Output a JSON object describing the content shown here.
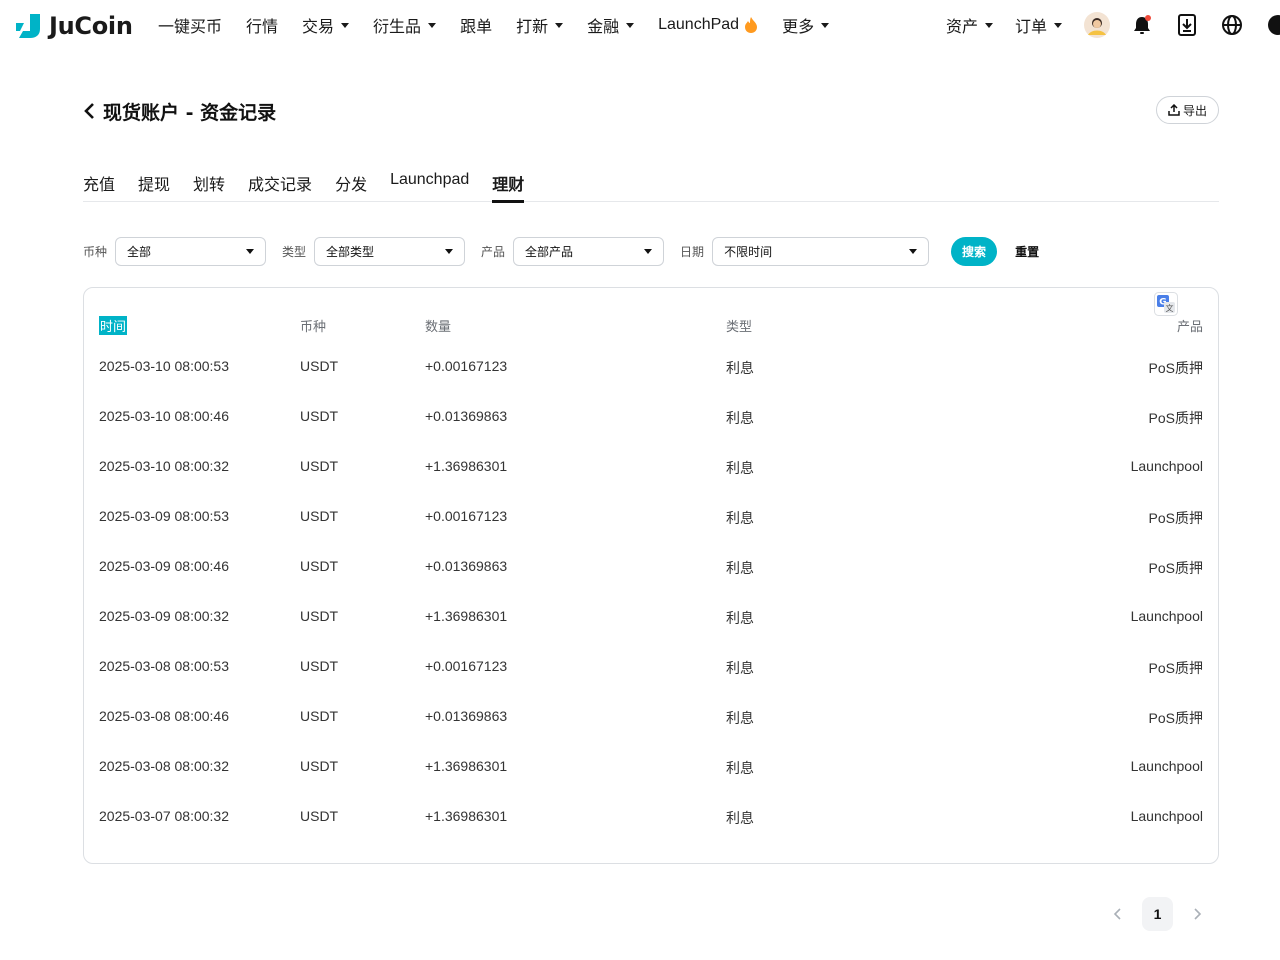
{
  "brand": {
    "name": "JuCoin",
    "accent": "#00b3c7"
  },
  "nav": {
    "items": [
      {
        "label": "一键买币",
        "dropdown": false
      },
      {
        "label": "行情",
        "dropdown": false
      },
      {
        "label": "交易",
        "dropdown": true
      },
      {
        "label": "衍生品",
        "dropdown": true
      },
      {
        "label": "跟单",
        "dropdown": false
      },
      {
        "label": "打新",
        "dropdown": true
      },
      {
        "label": "金融",
        "dropdown": true
      },
      {
        "label": "LaunchPad",
        "dropdown": false,
        "icon": "flame-icon"
      },
      {
        "label": "更多",
        "dropdown": true
      }
    ],
    "right": {
      "assets_label": "资产",
      "orders_label": "订单",
      "icons": [
        "avatar",
        "notification-bell-icon",
        "download-icon",
        "globe-icon",
        "theme-icon"
      ]
    }
  },
  "header": {
    "title": "现货账户 - 资金记录",
    "export_label": "导出"
  },
  "tabs": [
    {
      "label": "充值",
      "active": false
    },
    {
      "label": "提现",
      "active": false
    },
    {
      "label": "划转",
      "active": false
    },
    {
      "label": "成交记录",
      "active": false
    },
    {
      "label": "分发",
      "active": false
    },
    {
      "label": "Launchpad",
      "active": false
    },
    {
      "label": "理财",
      "active": true
    }
  ],
  "filters": {
    "coin": {
      "label": "币种",
      "value": "全部"
    },
    "type": {
      "label": "类型",
      "value": "全部类型"
    },
    "product": {
      "label": "产品",
      "value": "全部产品"
    },
    "date": {
      "label": "日期",
      "value": "不限时间"
    },
    "search_label": "搜索",
    "reset_label": "重置"
  },
  "table": {
    "columns": [
      "时间",
      "币种",
      "数量",
      "类型",
      "产品"
    ],
    "rows": [
      [
        "2025-03-10 08:00:53",
        "USDT",
        "+0.00167123",
        "利息",
        "PoS质押"
      ],
      [
        "2025-03-10 08:00:46",
        "USDT",
        "+0.01369863",
        "利息",
        "PoS质押"
      ],
      [
        "2025-03-10 08:00:32",
        "USDT",
        "+1.36986301",
        "利息",
        "Launchpool"
      ],
      [
        "2025-03-09 08:00:53",
        "USDT",
        "+0.00167123",
        "利息",
        "PoS质押"
      ],
      [
        "2025-03-09 08:00:46",
        "USDT",
        "+0.01369863",
        "利息",
        "PoS质押"
      ],
      [
        "2025-03-09 08:00:32",
        "USDT",
        "+1.36986301",
        "利息",
        "Launchpool"
      ],
      [
        "2025-03-08 08:00:53",
        "USDT",
        "+0.00167123",
        "利息",
        "PoS质押"
      ],
      [
        "2025-03-08 08:00:46",
        "USDT",
        "+0.01369863",
        "利息",
        "PoS质押"
      ],
      [
        "2025-03-08 08:00:32",
        "USDT",
        "+1.36986301",
        "利息",
        "Launchpool"
      ],
      [
        "2025-03-07 08:00:32",
        "USDT",
        "+1.36986301",
        "利息",
        "Launchpool"
      ]
    ]
  },
  "pagination": {
    "current": "1"
  }
}
